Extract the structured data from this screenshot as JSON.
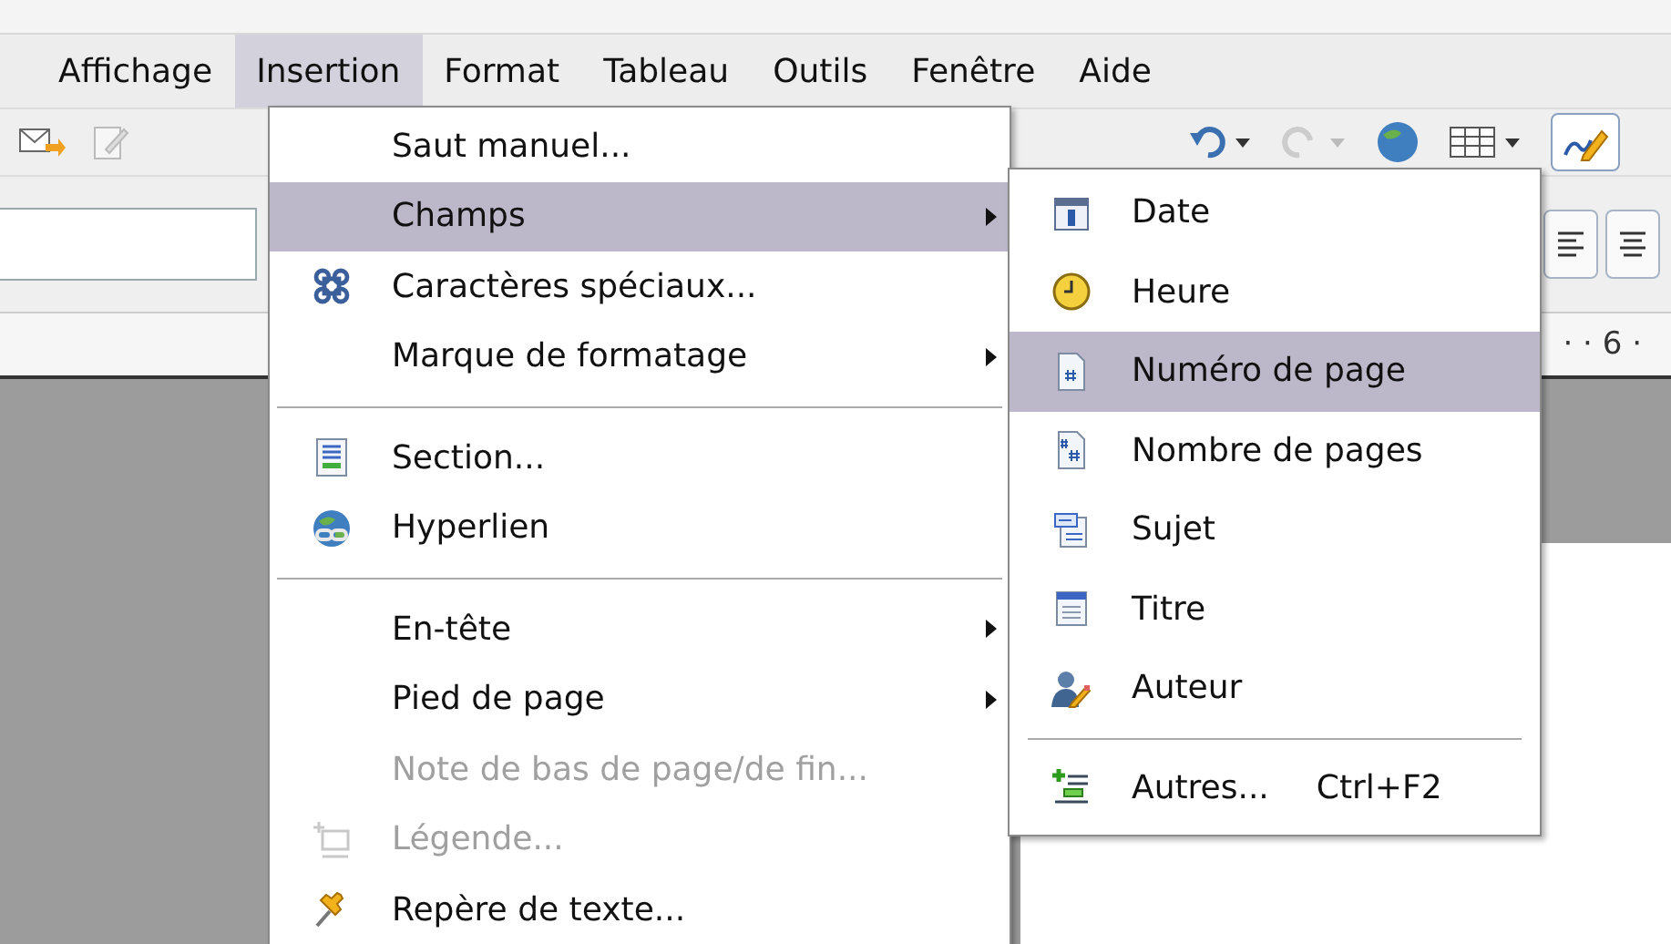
{
  "menubar": [
    {
      "label": "Affichage",
      "selected": false
    },
    {
      "label": "Insertion",
      "selected": true
    },
    {
      "label": "Format",
      "selected": false
    },
    {
      "label": "Tableau",
      "selected": false
    },
    {
      "label": "Outils",
      "selected": false
    },
    {
      "label": "Fenêtre",
      "selected": false
    },
    {
      "label": "Aide",
      "selected": false
    }
  ],
  "ruler": {
    "text": "· · 6 ·"
  },
  "menu": {
    "items": [
      {
        "kind": "item",
        "label": "Saut manuel...",
        "selected": false,
        "disabled": false,
        "submenu": false
      },
      {
        "kind": "item",
        "label": "Champs",
        "selected": true,
        "disabled": false,
        "submenu": true
      },
      {
        "kind": "item",
        "label": "Caractères spéciaux...",
        "selected": false,
        "disabled": false,
        "submenu": false
      },
      {
        "kind": "item",
        "label": "Marque de formatage",
        "selected": false,
        "disabled": false,
        "submenu": true
      },
      {
        "kind": "separator"
      },
      {
        "kind": "item",
        "label": "Section...",
        "selected": false,
        "disabled": false,
        "submenu": false
      },
      {
        "kind": "item",
        "label": "Hyperlien",
        "selected": false,
        "disabled": false,
        "submenu": false
      },
      {
        "kind": "separator"
      },
      {
        "kind": "item",
        "label": "En-tête",
        "selected": false,
        "disabled": false,
        "submenu": true
      },
      {
        "kind": "item",
        "label": "Pied de page",
        "selected": false,
        "disabled": false,
        "submenu": true
      },
      {
        "kind": "item",
        "label": "Note de bas de page/de fin...",
        "selected": false,
        "disabled": true,
        "submenu": false
      },
      {
        "kind": "item",
        "label": "Légende...",
        "selected": false,
        "disabled": true,
        "submenu": false
      },
      {
        "kind": "item",
        "label": "Repère de texte...",
        "selected": false,
        "disabled": false,
        "submenu": false
      }
    ]
  },
  "submenu": {
    "items": [
      {
        "kind": "item",
        "label": "Date",
        "selected": false,
        "disabled": false,
        "submenu": false
      },
      {
        "kind": "item",
        "label": "Heure",
        "selected": false,
        "disabled": false,
        "submenu": false
      },
      {
        "kind": "item",
        "label": "Numéro de page",
        "selected": true,
        "disabled": false,
        "submenu": false
      },
      {
        "kind": "item",
        "label": "Nombre de pages",
        "selected": false,
        "disabled": false,
        "submenu": false
      },
      {
        "kind": "item",
        "label": "Sujet",
        "selected": false,
        "disabled": false,
        "submenu": false
      },
      {
        "kind": "item",
        "label": "Titre",
        "selected": false,
        "disabled": false,
        "submenu": false
      },
      {
        "kind": "item",
        "label": "Auteur",
        "selected": false,
        "disabled": false,
        "submenu": false
      },
      {
        "kind": "separator"
      },
      {
        "kind": "item",
        "label": "Autres...",
        "shortcut": "Ctrl+F2",
        "selected": false,
        "disabled": false,
        "submenu": false
      }
    ]
  }
}
